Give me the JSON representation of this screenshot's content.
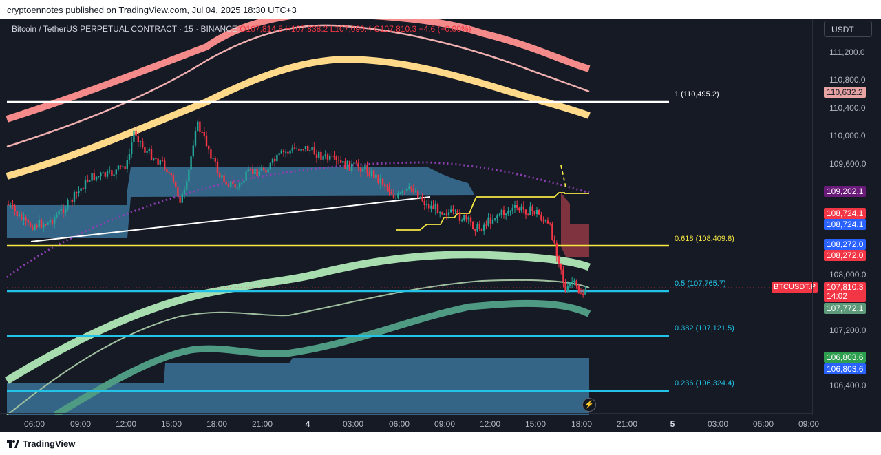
{
  "publisher_line": "cryptoennotes published on TradingView.com, Jul 04, 2025 18:30 UTC+3",
  "legend": {
    "symbol": "Bitcoin / TetherUS PERPETUAL CONTRACT · 15 · BINANCE",
    "open": "O107,814.8",
    "high": "H107,838.2",
    "low": "L107,090.4",
    "close": "C107,810.3",
    "change": "−4.6 (−0.00%)"
  },
  "currency": "USDT",
  "price_ticks": [
    "111,200.0",
    "110,800.0",
    "110,400.0",
    "110,000.0",
    "109,600.0",
    "108,000.0",
    "107,200.0",
    "106,400.0"
  ],
  "price_tags": {
    "t110632": "110,632.2",
    "t109202": "109,202.1",
    "t108724a": "108,724.1",
    "t108724b": "108,724.1",
    "t108272a": "108,272.0",
    "t108272b": "108,272.0",
    "t107810": "107,810.3",
    "countdown": "14:02",
    "t107772": "107,772.1",
    "t106803a": "106,803.6",
    "t106803b": "106,803.6"
  },
  "pair_tag": "BTCUSDT.P",
  "fib_levels": {
    "f1": "1 (110,495.2)",
    "f618": "0.618 (108,409.8)",
    "f5": "0.5 (107,765.7)",
    "f382": "0.382 (107,121.5)",
    "f236": "0.236 (106,324.4)"
  },
  "time_labels": [
    "06:00",
    "09:00",
    "12:00",
    "15:00",
    "18:00",
    "21:00",
    "4",
    "03:00",
    "06:00",
    "09:00",
    "12:00",
    "15:00",
    "18:00",
    "21:00",
    "5",
    "03:00",
    "06:00",
    "09:00"
  ],
  "brand": "TradingView",
  "colors": {
    "background": "#161a25",
    "up": "#26a69a",
    "down": "#f23645",
    "fib_white": "#ffffff",
    "fib_yellow": "#f5e642",
    "fib_cyan": "#22c3e6"
  }
}
